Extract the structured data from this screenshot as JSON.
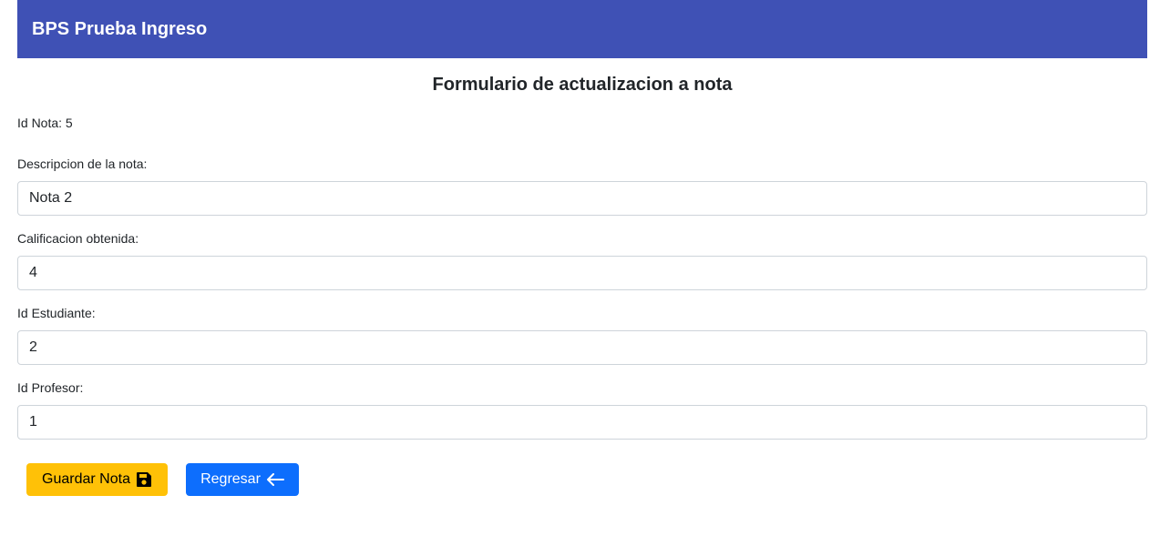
{
  "app": {
    "title": "BPS Prueba Ingreso",
    "toolbar_color": "#3f51b5"
  },
  "form": {
    "heading": "Formulario de actualizacion a nota",
    "id_nota_label": "Id Nota:",
    "id_nota_value": "5",
    "fields": [
      {
        "label": "Descripcion de la nota:",
        "value": "Nota 2"
      },
      {
        "label": "Calificacion obtenida:",
        "value": "4"
      },
      {
        "label": "Id Estudiante:",
        "value": "2"
      },
      {
        "label": "Id Profesor:",
        "value": "1"
      }
    ]
  },
  "buttons": {
    "save_label": "Guardar Nota",
    "save_icon": "floppy-disk-icon",
    "save_color": "#ffc107",
    "back_label": "Regresar",
    "back_icon": "arrow-left-icon",
    "back_color": "#0d6efd"
  }
}
